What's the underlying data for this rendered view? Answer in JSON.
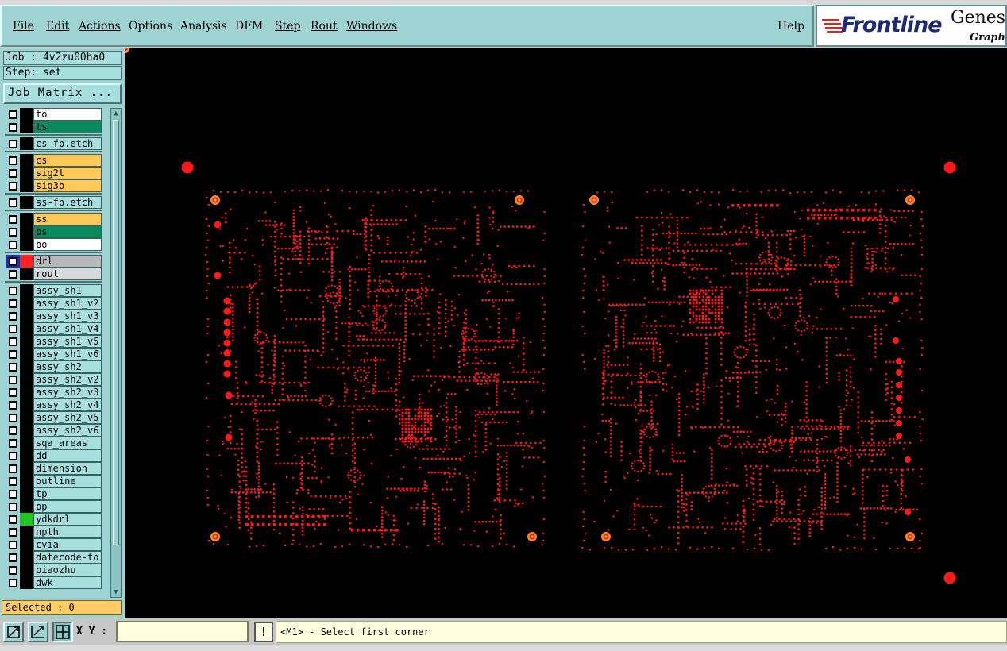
{
  "menu": [
    {
      "id": "file",
      "label": "File",
      "underline": true
    },
    {
      "id": "edit",
      "label": "Edit",
      "underline": true
    },
    {
      "id": "actions",
      "label": "Actions",
      "underline": true
    },
    {
      "id": "options",
      "label": "Options",
      "underline": false
    },
    {
      "id": "analysis",
      "label": "Analysis",
      "underline": false
    },
    {
      "id": "dfm",
      "label": "DFM",
      "underline": false
    },
    {
      "id": "step",
      "label": "Step",
      "underline": true
    },
    {
      "id": "rout",
      "label": "Rout",
      "underline": true
    },
    {
      "id": "windows",
      "label": "Windows",
      "underline": true
    }
  ],
  "help_label": "Help",
  "logo": {
    "brand": "Frontline",
    "product": "Genesis",
    "tagline": "Graphic",
    "brand_color": "#1c2a78",
    "accent_color": "#e0231c"
  },
  "job": {
    "label": "Job : 4v2zu00ha0"
  },
  "step": {
    "label": "Step: set"
  },
  "job_matrix_button": "Job Matrix ...",
  "layers": [
    {
      "name": "to",
      "color": "#ffffff",
      "swatch": "#000000",
      "group": 1
    },
    {
      "name": "ts",
      "color": "#0b8a5e",
      "swatch": "#000000",
      "group": 1
    },
    {
      "name": "cs-fp.etch",
      "color": "#a7dede",
      "swatch": "#000000",
      "group": 2
    },
    {
      "name": "cs",
      "color": "#ffc857",
      "swatch": "#000000",
      "group": 3
    },
    {
      "name": "sig2t",
      "color": "#ffc857",
      "swatch": "#000000",
      "group": 3
    },
    {
      "name": "sig3b",
      "color": "#ffc857",
      "swatch": "#000000",
      "group": 3
    },
    {
      "name": "ss-fp.etch",
      "color": "#a7dede",
      "swatch": "#000000",
      "group": 4
    },
    {
      "name": "ss",
      "color": "#ffc857",
      "swatch": "#000000",
      "group": 5
    },
    {
      "name": "bs",
      "color": "#0b8a5e",
      "swatch": "#000000",
      "group": 5
    },
    {
      "name": "bo",
      "color": "#ffffff",
      "swatch": "#000000",
      "group": 5
    },
    {
      "name": "drl",
      "color": "#b8b8b8",
      "swatch": "#ff2020",
      "group": 6,
      "active": true
    },
    {
      "name": "rout",
      "color": "#d8d8d8",
      "swatch": "#000000",
      "group": 6
    },
    {
      "name": "assy_sh1",
      "color": "#a7dede",
      "swatch": "#000000",
      "group": 7
    },
    {
      "name": "assy_sh1_v2",
      "color": "#a7dede",
      "swatch": "#000000",
      "group": 7
    },
    {
      "name": "assy_sh1_v3",
      "color": "#a7dede",
      "swatch": "#000000",
      "group": 7
    },
    {
      "name": "assy_sh1_v4",
      "color": "#a7dede",
      "swatch": "#000000",
      "group": 7
    },
    {
      "name": "assy_sh1_v5",
      "color": "#a7dede",
      "swatch": "#000000",
      "group": 7
    },
    {
      "name": "assy_sh1_v6",
      "color": "#a7dede",
      "swatch": "#000000",
      "group": 7
    },
    {
      "name": "assy_sh2",
      "color": "#a7dede",
      "swatch": "#000000",
      "group": 7
    },
    {
      "name": "assy_sh2_v2",
      "color": "#a7dede",
      "swatch": "#000000",
      "group": 7
    },
    {
      "name": "assy_sh2_v3",
      "color": "#a7dede",
      "swatch": "#000000",
      "group": 7
    },
    {
      "name": "assy_sh2_v4",
      "color": "#a7dede",
      "swatch": "#000000",
      "group": 7
    },
    {
      "name": "assy_sh2_v5",
      "color": "#a7dede",
      "swatch": "#000000",
      "group": 7
    },
    {
      "name": "assy_sh2_v6",
      "color": "#a7dede",
      "swatch": "#000000",
      "group": 7
    },
    {
      "name": "sqa_areas",
      "color": "#a7dede",
      "swatch": "#000000",
      "group": 7
    },
    {
      "name": "dd",
      "color": "#a7dede",
      "swatch": "#000000",
      "group": 7
    },
    {
      "name": "dimension",
      "color": "#a7dede",
      "swatch": "#000000",
      "group": 7
    },
    {
      "name": "outline",
      "color": "#a7dede",
      "swatch": "#000000",
      "group": 7
    },
    {
      "name": "tp",
      "color": "#a7dede",
      "swatch": "#000000",
      "group": 7
    },
    {
      "name": "bp",
      "color": "#a7dede",
      "swatch": "#000000",
      "group": 7
    },
    {
      "name": "ydkdrl",
      "color": "#a7dede",
      "swatch": "#22c422",
      "group": 7
    },
    {
      "name": "npth",
      "color": "#a7dede",
      "swatch": "#000000",
      "group": 7
    },
    {
      "name": "cvia",
      "color": "#a7dede",
      "swatch": "#000000",
      "group": 7
    },
    {
      "name": "datecode-to",
      "color": "#a7dede",
      "swatch": "#000000",
      "group": 7
    },
    {
      "name": "biaozhu",
      "color": "#a7dede",
      "swatch": "#000000",
      "group": 7
    },
    {
      "name": "dwk",
      "color": "#a7dede",
      "swatch": "#000000",
      "group": 7
    }
  ],
  "selected": {
    "label": "Selected : 0"
  },
  "canvas": {
    "background": "#000000",
    "drill_color": "#ff1a1a",
    "drill_dim_color": "#c81010"
  },
  "status": {
    "xy_label": "X Y :",
    "xy_value": "",
    "warn_symbol": "!",
    "prompt": "<M1> - Select first corner"
  },
  "colors": {
    "panel": "#9fd3d3",
    "selected_bg": "#ffcc66",
    "prompt_bg": "#ffffe0"
  }
}
